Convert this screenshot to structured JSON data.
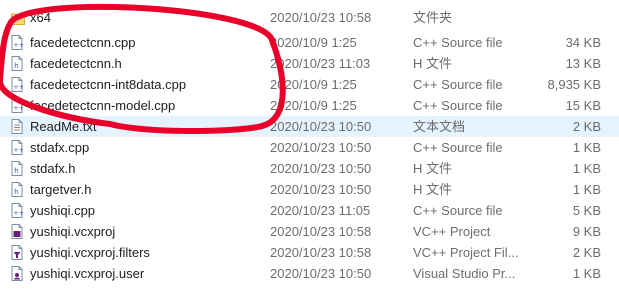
{
  "files": [
    {
      "name": "x64",
      "date": "2020/10/23 10:58",
      "type": "文件夹",
      "size": "",
      "icon": "folder-icon"
    },
    {
      "name": "facedetectcnn.cpp",
      "date": "2020/10/9 1:25",
      "type": "C++ Source file",
      "size": "34 KB",
      "icon": "cpp-file-icon"
    },
    {
      "name": "facedetectcnn.h",
      "date": "2020/10/23 11:03",
      "type": "H 文件",
      "size": "13 KB",
      "icon": "h-file-icon"
    },
    {
      "name": "facedetectcnn-int8data.cpp",
      "date": "2020/10/9 1:25",
      "type": "C++ Source file",
      "size": "8,935 KB",
      "icon": "cpp-file-icon"
    },
    {
      "name": "facedetectcnn-model.cpp",
      "date": "2020/10/9 1:25",
      "type": "C++ Source file",
      "size": "15 KB",
      "icon": "cpp-file-icon"
    },
    {
      "name": "ReadMe.txt",
      "date": "2020/10/23 10:50",
      "type": "文本文档",
      "size": "2 KB",
      "icon": "text-file-icon",
      "selected": true
    },
    {
      "name": "stdafx.cpp",
      "date": "2020/10/23 10:50",
      "type": "C++ Source file",
      "size": "1 KB",
      "icon": "cpp-file-icon"
    },
    {
      "name": "stdafx.h",
      "date": "2020/10/23 10:50",
      "type": "H 文件",
      "size": "1 KB",
      "icon": "h-file-icon"
    },
    {
      "name": "targetver.h",
      "date": "2020/10/23 10:50",
      "type": "H 文件",
      "size": "1 KB",
      "icon": "h-file-icon"
    },
    {
      "name": "yushiqi.cpp",
      "date": "2020/10/23 11:05",
      "type": "C++ Source file",
      "size": "5 KB",
      "icon": "cpp-file-icon"
    },
    {
      "name": "yushiqi.vcxproj",
      "date": "2020/10/23 10:58",
      "type": "VC++ Project",
      "size": "9 KB",
      "icon": "vcxproj-file-icon"
    },
    {
      "name": "yushiqi.vcxproj.filters",
      "date": "2020/10/23 10:58",
      "type": "VC++ Project Fil...",
      "size": "2 KB",
      "icon": "filters-file-icon"
    },
    {
      "name": "yushiqi.vcxproj.user",
      "date": "2020/10/23 10:50",
      "type": "Visual Studio Pr...",
      "size": "1 KB",
      "icon": "user-file-icon"
    }
  ],
  "annotation_color": "#e8002a"
}
